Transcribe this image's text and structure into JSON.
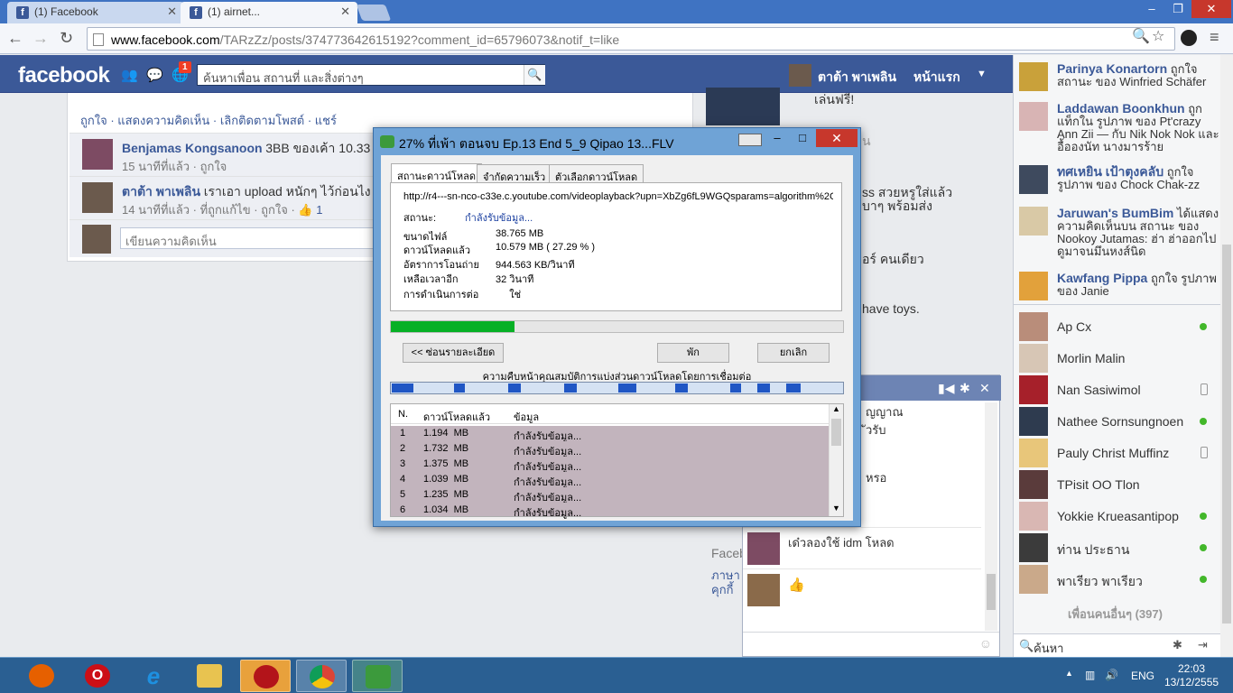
{
  "browser": {
    "tabs": [
      {
        "label": "(1) Facebook",
        "active": false
      },
      {
        "label": "(1) airnet...",
        "active": true
      }
    ],
    "url_host": "www.facebook.com",
    "url_rest": "/TARzZz/posts/374773642615192?comment_id=65796073&notif_t=like",
    "window_controls": [
      "–",
      "❐",
      "✕"
    ]
  },
  "facebook": {
    "logo": "facebook",
    "notif_count": "1",
    "search_placeholder": "ค้นหาเพื่อน สถานที่ และสิ่งต่างๆ",
    "username": "ตาต้า พาเพลิน",
    "home_label": "หน้าแรก",
    "post_actions": "ถูกใจ · แสดงความคิดเห็น · เลิกติดตามโพสต์ · แชร์",
    "comments": [
      {
        "name": "Benjamas Kongsanoon",
        "text": "3BB ของเค้า 10.33",
        "meta": "15 นาทีที่แล้ว · ถูกใจ"
      },
      {
        "name": "ตาต้า พาเพลิน",
        "text": "เราเอา upload หนักๆ ไว้ก่อนไง 5",
        "meta": "14 นาทีที่แล้ว · ที่ถูกแก้ไข · ถูกใจ · ",
        "likes": "1"
      }
    ],
    "write_comment_placeholder": "เขียนความคิดเห็น",
    "feed_right": {
      "line1": "เล่นฟรี!",
      "line2": "น",
      "line3": "ss สวยหรูใส่แล้ว",
      "line4": "บาๆ พร้อมส่ง",
      "line5": "อร์ คนเดียว",
      "line6": "have toys.",
      "line7": "Faceb",
      "line8": "ภาษา",
      "line9": "คุกกี้"
    },
    "chat": {
      "snippets": [
        "ญญาณ",
        "ัวรับ",
        "หรอ"
      ],
      "message": "เด๋วลองใช้ idm โหลด"
    }
  },
  "sidebar": {
    "ticker": [
      {
        "name": "Parinya Konartorn",
        "text": "ถูกใจ สถานะ ของ Winfried Schäfer"
      },
      {
        "name": "Laddawan Boonkhun",
        "text": "ถูกแท็กใน รูปภาพ ของ Pt'crazy Ann Zii — กับ Nik Nok Nok และ อื้อองนัท นางมารร้าย"
      },
      {
        "name": "ทศเหยิน เป้าตุงคลับ",
        "text": "ถูกใจ รูปภาพ ของ Chock Chak-zz"
      },
      {
        "name": "Jaruwan's BumBim",
        "text": "ได้แสดงความคิดเห็นบน สถานะ ของ Nookoy Jutamas: ฮ่า ฮ่าออกไปดูมาจนมึนหงส์นิด"
      },
      {
        "name": "Kawfang Pippa",
        "text": "ถูกใจ รูปภาพ ของ Janie"
      }
    ],
    "buddies": [
      {
        "name": "Ap Cx",
        "status": "online"
      },
      {
        "name": "Morlin Malin",
        "status": "none"
      },
      {
        "name": "Nan Sasiwimol",
        "status": "mobile"
      },
      {
        "name": "Nathee Sornsungnoen",
        "status": "online"
      },
      {
        "name": "Pauly Christ Muffinz",
        "status": "mobile"
      },
      {
        "name": "TPisit OO Tlon",
        "status": "none"
      },
      {
        "name": "Yokkie Krueasantipop",
        "status": "online"
      },
      {
        "name": "ท่าน ประธาน",
        "status": "online"
      },
      {
        "name": "พาเรียว พาเรียว",
        "status": "online"
      }
    ],
    "more_friends": "เพื่อนคนอื่นๆ (397)",
    "search_label": "ค้นหา"
  },
  "idm": {
    "title": "27% ที่เพ้า ตอนจบ Ep.13 End 5_9 Qipao 13...FLV",
    "tabs": [
      "สถานะดาวน์โหลด",
      "จำกัดความเร็ว",
      "ตัวเลือกดาวน์โหลด"
    ],
    "url": "http://r4---sn-nco-c33e.c.youtube.com/videoplayback?upn=XbZg6fL9WGQsparams=algorithm%2Cburst",
    "status_label": "สถานะ:",
    "status_value": "กำลังรับข้อมูล...",
    "rows": [
      {
        "label": "ขนาดไฟล์",
        "value": "38.765  MB"
      },
      {
        "label": "ดาวน์โหลดแล้ว",
        "value": "10.579  MB  ( 27.29 % )"
      },
      {
        "label": "อัตราการโอนถ่าย",
        "value": "944.563  KB/วินาที"
      },
      {
        "label": "เหลือเวลาอีก",
        "value": "32 วินาที"
      },
      {
        "label": "การดำเนินการต่อ",
        "value": "     ใช่"
      }
    ],
    "progress": 0.2729,
    "buttons": {
      "hide": "<< ซ่อนรายละเอียด",
      "pause": "พัก",
      "cancel": "ยกเลิก"
    },
    "conn_label": "ความคืบหน้าคุณสมบัติการแบ่งส่วนดาวน์โหลดโดยการเชื่อมต่อ",
    "table_headers": [
      "N.",
      "ดาวน์โหลดแล้ว",
      "ข้อมูล"
    ],
    "connections": [
      {
        "n": "1",
        "downloaded": "1.194  MB",
        "info": "กำลังรับข้อมูล..."
      },
      {
        "n": "2",
        "downloaded": "1.732  MB",
        "info": "กำลังรับข้อมูล..."
      },
      {
        "n": "3",
        "downloaded": "1.375  MB",
        "info": "กำลังรับข้อมูล..."
      },
      {
        "n": "4",
        "downloaded": "1.039  MB",
        "info": "กำลังรับข้อมูล..."
      },
      {
        "n": "5",
        "downloaded": "1.235  MB",
        "info": "กำลังรับข้อมูล..."
      },
      {
        "n": "6",
        "downloaded": "1.034  MB",
        "info": "กำลังรับข้อมูล..."
      }
    ]
  },
  "taskbar": {
    "apps": [
      {
        "name": "firefox",
        "glyph": "",
        "color": "#e66000"
      },
      {
        "name": "opera",
        "glyph": "O",
        "color": "#cc0f16"
      },
      {
        "name": "internet-explorer",
        "glyph": "e",
        "color": "#1e90e0"
      },
      {
        "name": "file-explorer",
        "glyph": "",
        "color": "#e8c350"
      },
      {
        "name": "app-red",
        "glyph": "",
        "color": "#b3141a"
      },
      {
        "name": "chrome",
        "glyph": "",
        "color": "#3a8d3a"
      },
      {
        "name": "idm",
        "glyph": "",
        "color": "#3c9a3c"
      }
    ],
    "lang": "ENG",
    "time": "22:03",
    "date": "13/12/2555"
  }
}
